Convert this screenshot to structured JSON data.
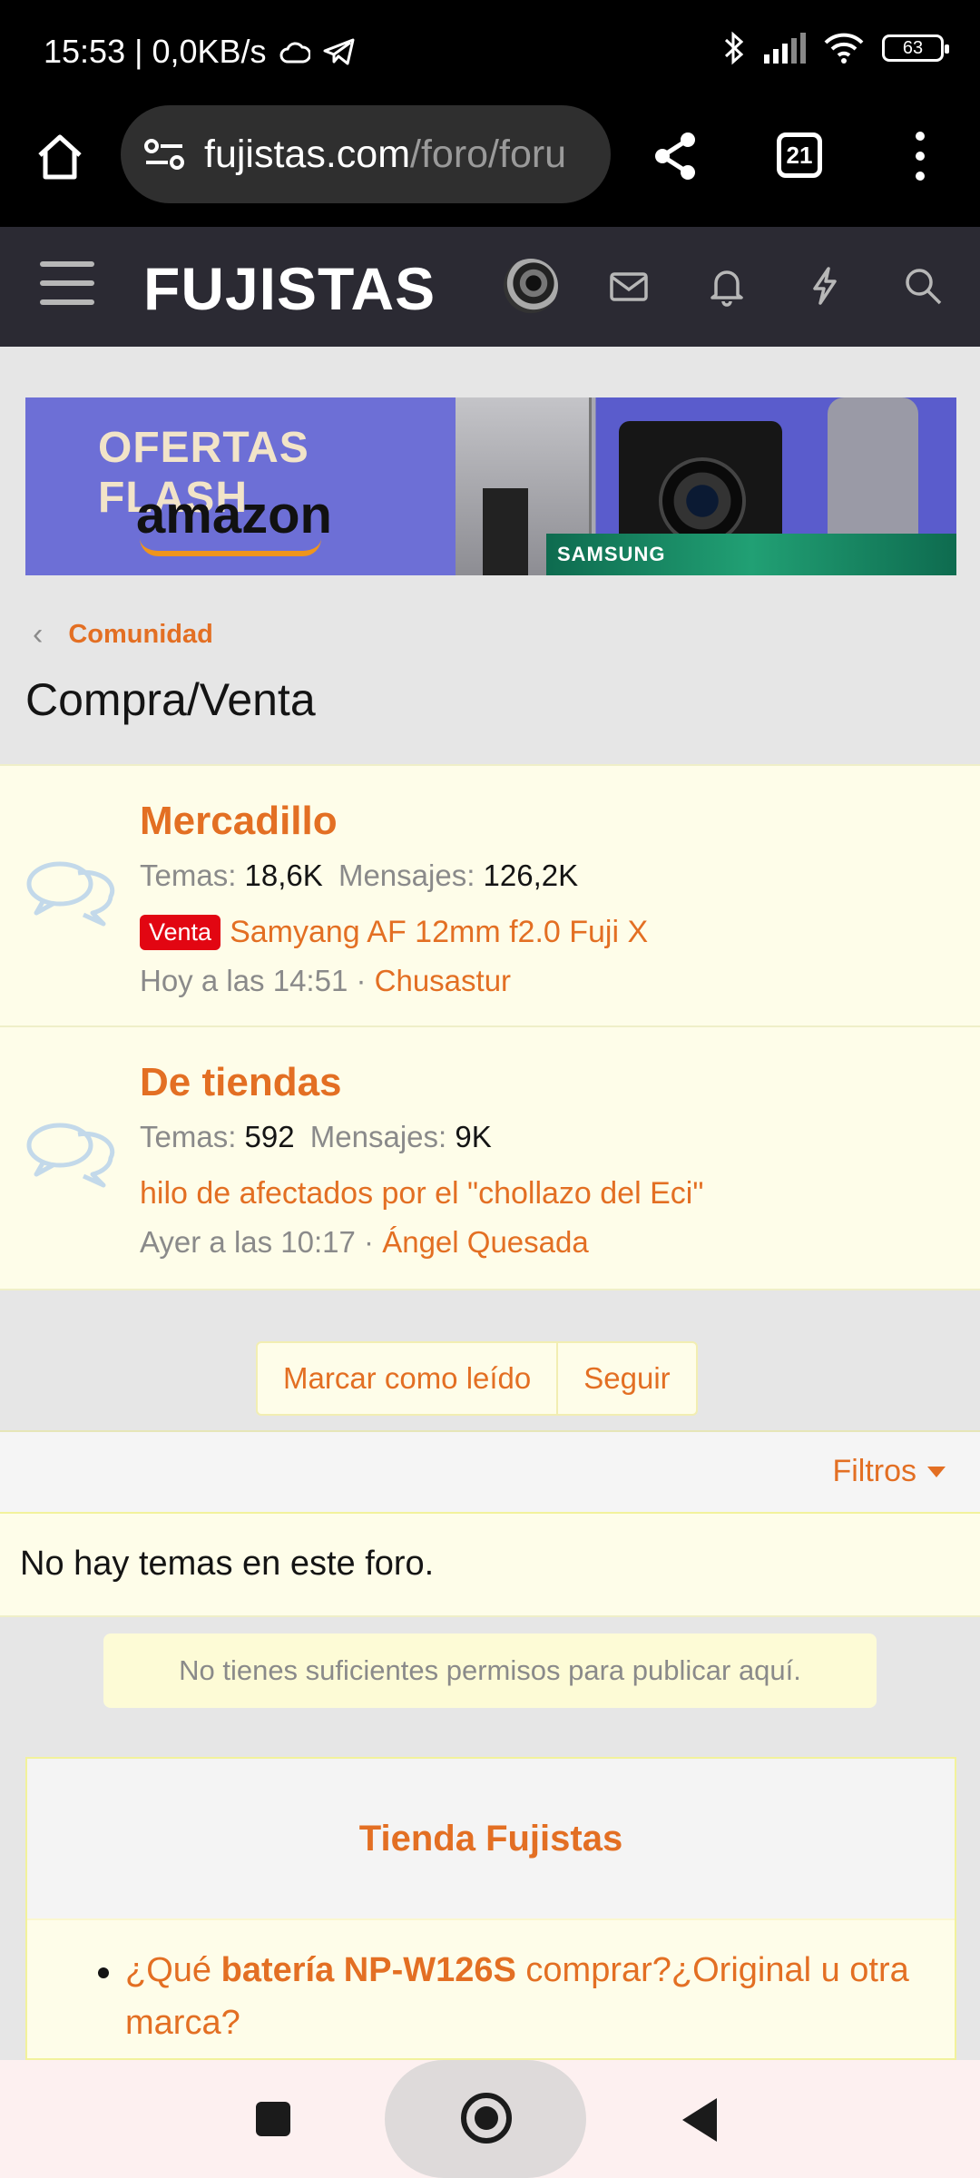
{
  "status_bar": {
    "time_speed": "15:53 | 0,0KB/s",
    "battery": "63"
  },
  "browser": {
    "url_domain": "fujistas.com",
    "url_path": "/foro/foru",
    "tab_count": "21"
  },
  "site": {
    "logo": "FUJISTAS"
  },
  "banner": {
    "title": "OFERTAS FLASH",
    "brand": "amazon",
    "tv_brand": "SAMSUNG"
  },
  "breadcrumb": {
    "label": "Comunidad"
  },
  "page_title": "Compra/Venta",
  "nodes": [
    {
      "title": "Mercadillo",
      "temas_label": "Temas:",
      "temas": "18,6K",
      "mensajes_label": "Mensajes:",
      "mensajes": "126,2K",
      "tag": "Venta",
      "latest": "Samyang AF 12mm f2.0 Fuji X",
      "time": "Hoy a las 14:51 ·",
      "user": "Chusastur"
    },
    {
      "title": "De tiendas",
      "temas_label": "Temas:",
      "temas": "592",
      "mensajes_label": "Mensajes:",
      "mensajes": "9K",
      "latest": "hilo de afectados por el \"chollazo del Eci\"",
      "time": "Ayer a las 10:17 ·",
      "user": "Ángel Quesada"
    }
  ],
  "actions": {
    "mark_read": "Marcar como leído",
    "follow": "Seguir"
  },
  "filters_label": "Filtros",
  "empty_text": "No hay temas en este foro.",
  "notice": "No tienes suficientes permisos para publicar aquí.",
  "store": {
    "title": "Tienda Fujistas",
    "item_prefix": "¿Qué ",
    "item_bold": "batería NP-W126S",
    "item_suffix": " comprar?¿Original u otra marca?"
  },
  "colors": {
    "accent": "#e36f23",
    "header_bg": "#2b2a33",
    "tag_red": "#e20612"
  }
}
